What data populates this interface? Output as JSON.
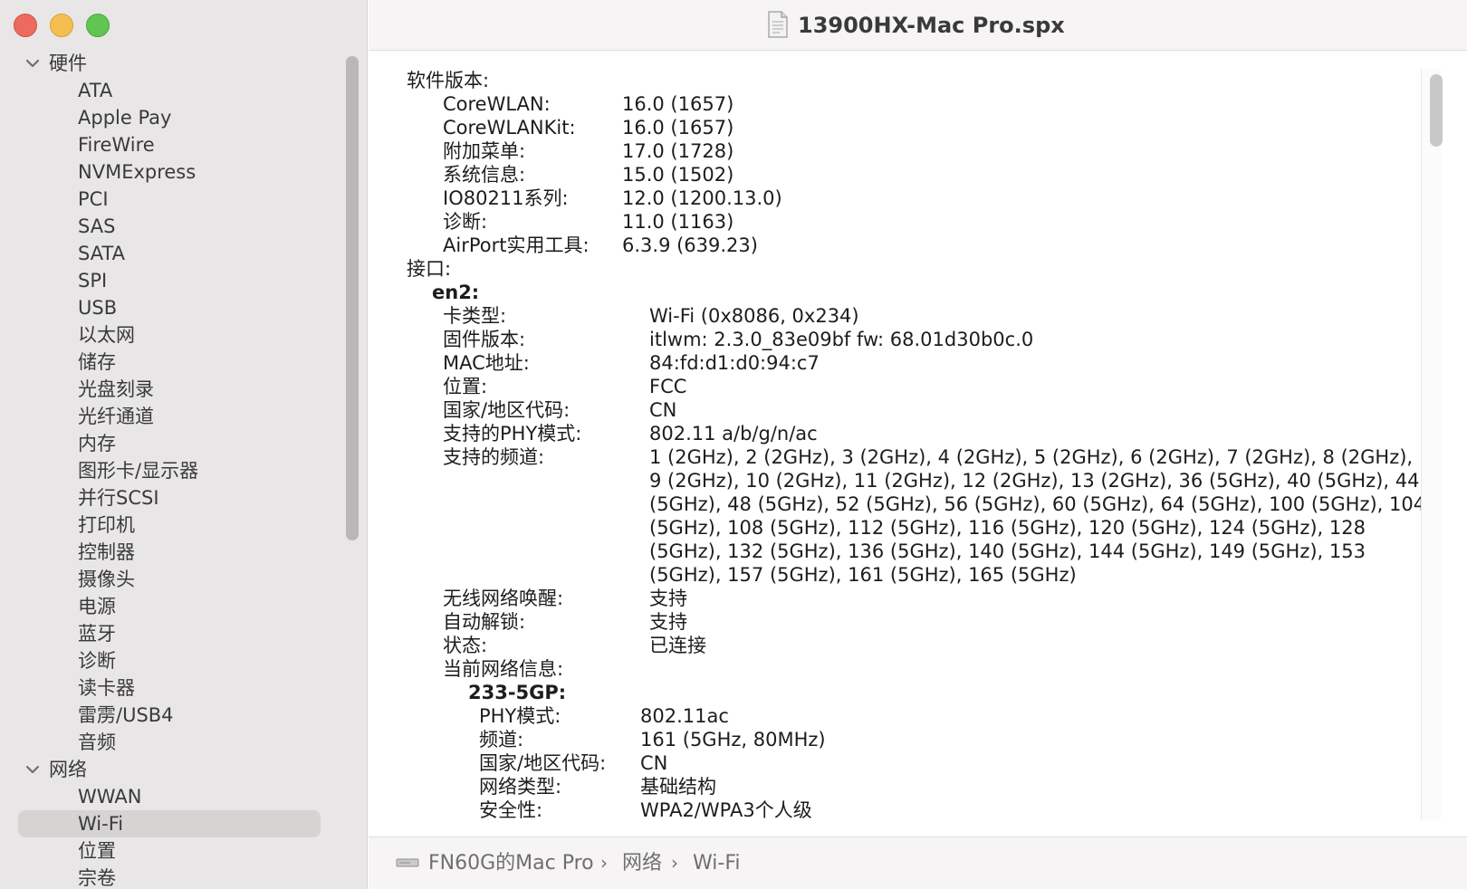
{
  "window": {
    "title": "13900HX-Mac Pro.spx"
  },
  "sidebar": {
    "hardware_label": "硬件",
    "hardware_items": [
      "ATA",
      "Apple Pay",
      "FireWire",
      "NVMExpress",
      "PCI",
      "SAS",
      "SATA",
      "SPI",
      "USB",
      "以太网",
      "储存",
      "光盘刻录",
      "光纤通道",
      "内存",
      "图形卡/显示器",
      "并行SCSI",
      "打印机",
      "控制器",
      "摄像头",
      "电源",
      "蓝牙",
      "诊断",
      "读卡器",
      "雷雳/USB4",
      "音频"
    ],
    "network_label": "网络",
    "network_items": [
      "WWAN",
      "Wi-Fi",
      "位置",
      "宗卷"
    ],
    "selected": "Wi-Fi"
  },
  "software": {
    "heading": "软件版本:",
    "rows": [
      {
        "k": "CoreWLAN:",
        "v": "16.0 (1657)"
      },
      {
        "k": "CoreWLANKit:",
        "v": "16.0 (1657)"
      },
      {
        "k": "附加菜单:",
        "v": "17.0 (1728)"
      },
      {
        "k": "系统信息:",
        "v": "15.0 (1502)"
      },
      {
        "k": "IO80211系列:",
        "v": "12.0 (1200.13.0)"
      },
      {
        "k": "诊断:",
        "v": "11.0 (1163)"
      },
      {
        "k": "AirPort实用工具:",
        "v": "6.3.9 (639.23)"
      }
    ]
  },
  "interfaces": {
    "heading": "接口:",
    "name": "en2:",
    "rows": [
      {
        "k": "卡类型:",
        "v": "Wi-Fi  (0x8086, 0x234)"
      },
      {
        "k": "固件版本:",
        "v": "itlwm: 2.3.0_83e09bf fw: 68.01d30b0c.0"
      },
      {
        "k": "MAC地址:",
        "v": "84:fd:d1:d0:94:c7"
      },
      {
        "k": "位置:",
        "v": "FCC"
      },
      {
        "k": "国家/地区代码:",
        "v": "CN"
      },
      {
        "k": "支持的PHY模式:",
        "v": "802.11 a/b/g/n/ac"
      }
    ],
    "channels_label": "支持的频道:",
    "channels_value": "1 (2GHz), 2 (2GHz), 3 (2GHz), 4 (2GHz), 5 (2GHz), 6 (2GHz), 7 (2GHz), 8 (2GHz), 9 (2GHz), 10 (2GHz), 11 (2GHz), 12 (2GHz), 13 (2GHz), 36 (5GHz), 40 (5GHz), 44 (5GHz), 48 (5GHz), 52 (5GHz), 56 (5GHz), 60 (5GHz), 64 (5GHz), 100 (5GHz), 104 (5GHz), 108 (5GHz), 112 (5GHz), 116 (5GHz), 120 (5GHz), 124 (5GHz), 128 (5GHz), 132 (5GHz), 136 (5GHz), 140 (5GHz), 144 (5GHz), 149 (5GHz), 153 (5GHz), 157 (5GHz), 161 (5GHz), 165 (5GHz)",
    "rows2": [
      {
        "k": "无线网络唤醒:",
        "v": "支持"
      },
      {
        "k": "自动解锁:",
        "v": "支持"
      },
      {
        "k": "状态:",
        "v": "已连接"
      }
    ],
    "current_label": "当前网络信息:",
    "network_name": "233-5GP:",
    "network_rows": [
      {
        "k": "PHY模式:",
        "v": "802.11ac"
      },
      {
        "k": "频道:",
        "v": "161 (5GHz, 80MHz)"
      },
      {
        "k": "国家/地区代码:",
        "v": "CN"
      },
      {
        "k": "网络类型:",
        "v": "基础结构"
      },
      {
        "k": "安全性:",
        "v": "WPA2/WPA3个人级"
      }
    ]
  },
  "footer": {
    "device": "FN60G的Mac Pro",
    "section": "网络",
    "item": "Wi-Fi"
  }
}
